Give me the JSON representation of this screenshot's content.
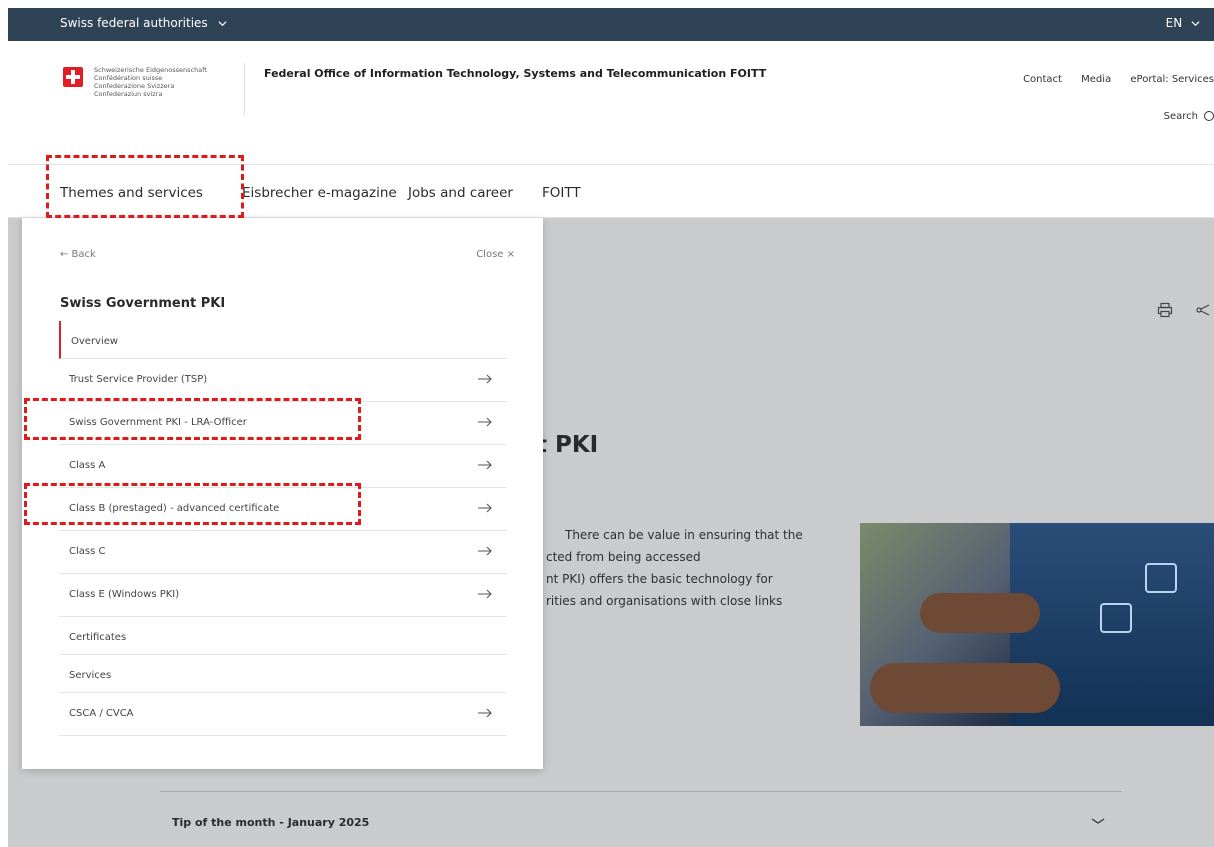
{
  "topbar": {
    "federal": "Swiss federal authorities",
    "lang": "EN"
  },
  "header": {
    "confed_lines": [
      "Schweizerische Eidgenossenschaft",
      "Confédération suisse",
      "Confederazione Svizzera",
      "Confederaziun svizra"
    ],
    "org": "Federal Office of Information Technology, Systems and Telecommunication FOITT",
    "links": [
      "Contact",
      "Media",
      "ePortal: Services"
    ],
    "search": "Search"
  },
  "nav": {
    "items": [
      "Themes and services",
      "Eisbrecher e-magazine",
      "Jobs and career",
      "FOITT"
    ]
  },
  "panel": {
    "back": "← Back",
    "close": "Close ×",
    "title": "Swiss Government PKI",
    "items": [
      "Overview",
      "Trust Service Provider (TSP)",
      "Swiss Government PKI - LRA-Officer",
      "Class A",
      "Class B (prestaged) - advanced certificate",
      "Class C",
      "Class E (Windows PKI)",
      "Certificates",
      "Services",
      "CSCA / CVCA"
    ]
  },
  "main": {
    "title_fragment": "t PKI",
    "para_lines": [
      "There can be value in ensuring that the",
      "cted from being accessed",
      "nt PKI) offers the basic technology for",
      "rities and organisations with close links"
    ],
    "tip": "Tip of the month - January 2025"
  },
  "colors": {
    "topbar": "#2f4356",
    "accent_red": "#d8232a",
    "highlight": "#e01919",
    "content_bg": "#cacbcd"
  }
}
